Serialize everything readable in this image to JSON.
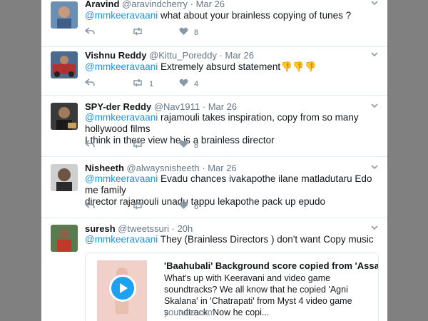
{
  "tweets": [
    {
      "name": "Aravind",
      "handle": "@aravindcherry",
      "dot": "·",
      "time": "Mar 26",
      "mention": "@mmkeeravaani",
      "text": " what about your brainless copying of tunes ?",
      "text2": "",
      "reply_count": "",
      "retweet_count": "",
      "like_count": "8"
    },
    {
      "name": "Vishnu Reddy",
      "handle": "@Kittu_Poreddy",
      "dot": "·",
      "time": "Mar 26",
      "mention": "@mmkeeravaani",
      "text": " Extremely absurd statement",
      "emoji": "👎👎👎",
      "text2": "",
      "reply_count": "",
      "retweet_count": "1",
      "like_count": "4"
    },
    {
      "name": "SPY-der Reddy",
      "handle": "@Nav1911",
      "dot": "·",
      "time": "Mar 26",
      "mention": "@mmkeeravaani",
      "text": " rajamouli takes inspiration, copy from so many hollywood films",
      "text2": "I think in there view he is a brainless director",
      "reply_count": "",
      "retweet_count": "",
      "like_count": "8"
    },
    {
      "name": "Nisheeth",
      "handle": "@alwaysnisheeth",
      "dot": "·",
      "time": "Mar 26",
      "mention": "@mmkeeravaani",
      "text": " Evadu chances ivakapothe ilane matladutaru Edo me family",
      "text2": "director rajamouli unadu tappu lekapothe pack up epudo",
      "reply_count": "",
      "retweet_count": "",
      "like_count": "6"
    },
    {
      "name": "suresh",
      "handle": "@tweetssuri",
      "dot": "·",
      "time": "20h",
      "mention": "@mmkeeravaani",
      "text": " They (Brainless Directors ) don't want Copy music",
      "text2": "",
      "card": {
        "title": "'Baahubali' Background score copied from 'Assasi...",
        "description": "What's up with Keeravani and video game soundtracks? We all know that he copied 'Agni Skalana' in 'Chatrapati' from Myst 4 video game soundtrack. Now he copi...",
        "domain": "youtube.com"
      }
    }
  ],
  "colors": {
    "mention": "#1b95e0",
    "icon": "#8899a6",
    "backdrop": "#808080",
    "youtube_play": "#1da1f2"
  },
  "icons": [
    "reply-icon",
    "retweet-icon",
    "like-icon",
    "caret-down-icon",
    "play-icon"
  ]
}
